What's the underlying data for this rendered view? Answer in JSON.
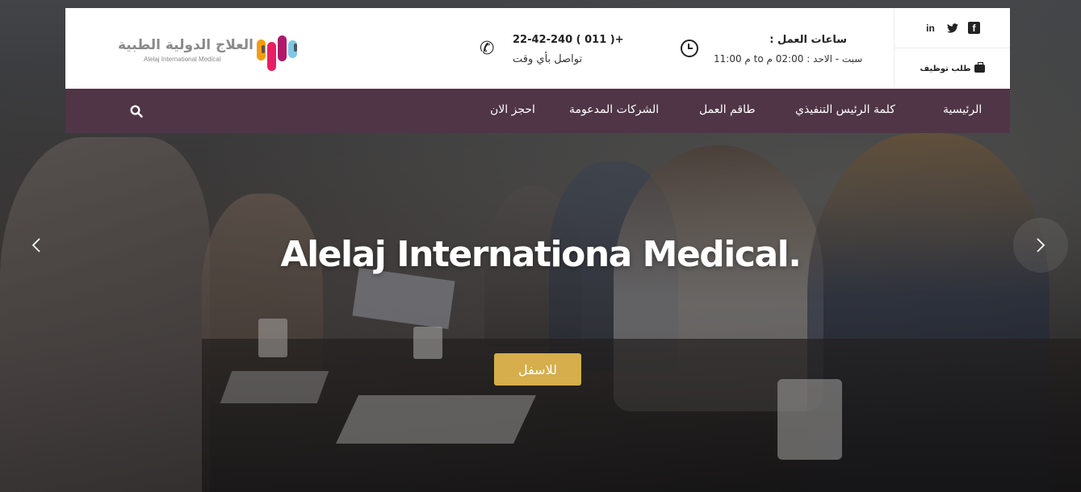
{
  "topbar": {
    "career_link": "طلب توظيف",
    "social": [
      "facebook-icon",
      "twitter-icon",
      "linkedin-icon"
    ],
    "hours_title": ": ساعات العمل",
    "hours_detail": "م 11:00 to سبت - الاحد : 02:00 م",
    "phone_number": "22-42-240 ( 011 )+",
    "phone_subtitle": "تواصل بأي وقت",
    "logo_ar": "العلاج الدولية الطبية",
    "logo_en": "Alelaj International Medical"
  },
  "nav": {
    "items": [
      "الرئيسية",
      "كلمة الرئيس التنفيذي",
      "طاقم العمل",
      "الشركات المدعومة",
      "احجز الان"
    ]
  },
  "hero": {
    "title": "Alelaj Internationa Medical.",
    "button": "للاسفل"
  },
  "colors": {
    "navbar": "#4f3546",
    "accent_button": "#d6ae4b",
    "logo_pills": [
      "#f39c12",
      "#e91e63",
      "#b0186a",
      "#7ec8e3"
    ]
  }
}
